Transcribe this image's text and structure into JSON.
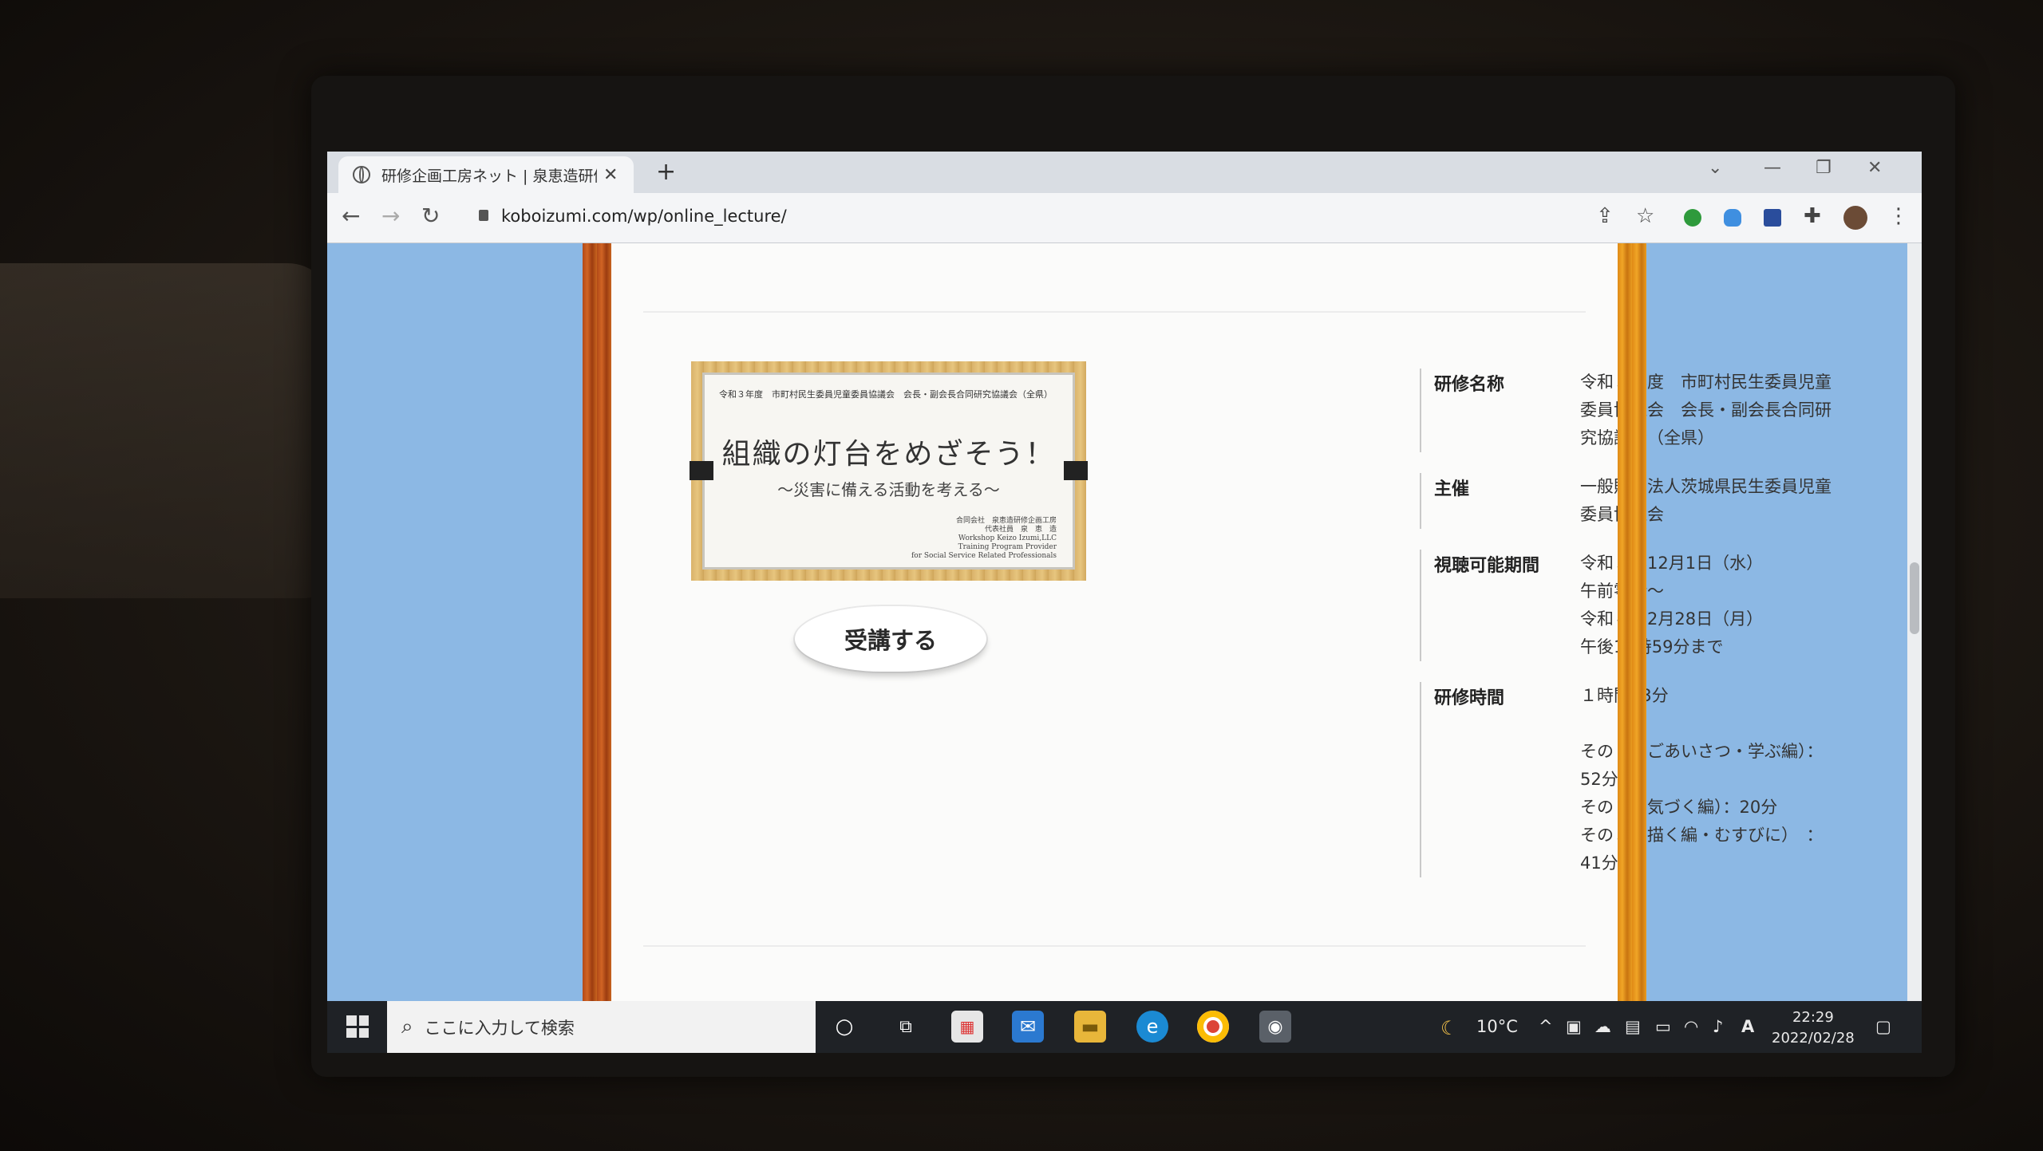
{
  "browser": {
    "tab_title": "研修企画工房ネット | 泉恵造研修",
    "url": "koboizumi.com/wp/online_lecture/"
  },
  "thumbnail": {
    "header": "令和３年度　市町村民生委員児童委員協議会　会長・副会長合同研究協議会（全県）",
    "title": "組織の灯台をめざそう！",
    "subtitle": "～災害に備える活動を考える～",
    "org": "合同会社　泉恵造研修企画工房\n代表社員　泉　恵　造\nWorkshop Keizo Izumi,LLC\nTraining Program Provider\nfor Social Service Related Professionals"
  },
  "button": {
    "label": "受講する"
  },
  "info": {
    "name_label": "研修名称",
    "name_value": "令和３年度　市町村民生委員児童委員協議会　会長・副会長合同研究協議会（全県）",
    "host_label": "主催",
    "host_value": "一般財団法人茨城県民生委員児童委員協議会",
    "period_label": "視聴可能期間",
    "period_lines": [
      "令和３年12月1日（水）",
      "午前零時～",
      "令和４年2月28日（月）",
      "午後11時59分まで"
    ],
    "time_label": "研修時間",
    "time_total": "１時間53分",
    "time_parts": [
      "その１（ごあいさつ・学ぶ編）：52分",
      "その２（気づく編）：20分",
      "その３（描く編・むすびに）　：41分"
    ]
  },
  "taskbar": {
    "search_placeholder": "ここに入力して検索",
    "weather": "10°C",
    "time": "22:29",
    "date": "2022/02/28"
  }
}
